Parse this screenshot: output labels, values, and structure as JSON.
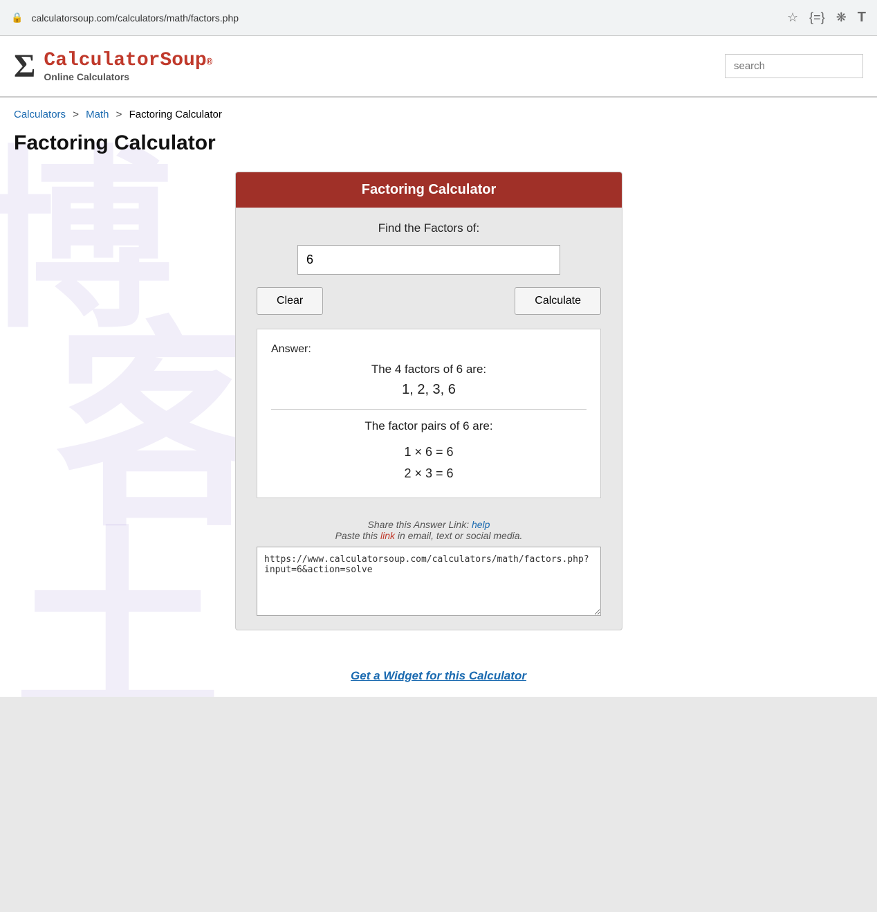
{
  "browser": {
    "url": "calculatorsoup.com/calculators/math/factors.php",
    "search_placeholder": "search"
  },
  "header": {
    "logo_name_part1": "Calculator",
    "logo_name_part2": "Soup",
    "logo_reg": "®",
    "logo_subtitle": "Online Calculators"
  },
  "breadcrumb": {
    "calculators_label": "Calculators",
    "sep1": ">",
    "math_label": "Math",
    "sep2": ">",
    "current": "Factoring Calculator"
  },
  "page_title": "Factoring Calculator",
  "calculator": {
    "title": "Factoring Calculator",
    "find_label": "Find the Factors of:",
    "input_value": "6",
    "clear_button": "Clear",
    "calculate_button": "Calculate",
    "answer_label": "Answer:",
    "factors_count_text": "The 4 factors of 6 are:",
    "factors_list": "1, 2, 3, 6",
    "factor_pairs_label": "The factor pairs of 6 are:",
    "factor_pair_1": "1 × 6 = 6",
    "factor_pair_2": "2 × 3 = 6",
    "share_text_1": "Share this Answer Link:",
    "share_help_link": "help",
    "share_text_2": "Paste this",
    "share_link_text": "link",
    "share_text_3": "in email, text or social media.",
    "share_url": "https://www.calculatorsoup.com/calculators/math/factors.php?input=6&action=solve",
    "widget_link": "Get a Widget for this Calculator"
  }
}
